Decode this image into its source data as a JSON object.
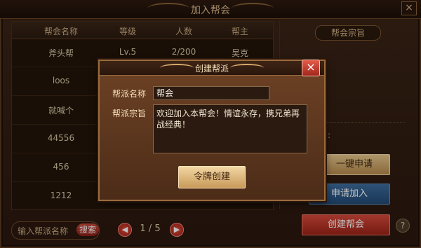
{
  "window": {
    "title": "加入帮会",
    "close_glyph": "×"
  },
  "guild_table": {
    "headers": [
      "帮会名称",
      "等级",
      "人数",
      "帮主"
    ],
    "rows": [
      [
        "斧头帮",
        "Lv.5",
        "2/200",
        "吴克"
      ],
      [
        "loos",
        "",
        "",
        ""
      ],
      [
        "就喊个",
        "",
        "",
        ""
      ],
      [
        "44556",
        "",
        "",
        ""
      ],
      [
        "456",
        "",
        "",
        ""
      ],
      [
        "1212",
        "",
        "",
        ""
      ]
    ]
  },
  "right_panel": {
    "tenet_tab": "帮会宗旨",
    "partial_label": "名:",
    "buttons": {
      "one_click_apply": "一键申请",
      "apply_join": "申请加入",
      "create_guild": "创建帮会"
    },
    "help_icon": "?"
  },
  "bottom": {
    "search_placeholder": "输入帮派名称",
    "search_button": "搜索",
    "pager": {
      "text": "1 / 5",
      "prev_glyph": "◀",
      "next_glyph": "▶"
    }
  },
  "modal": {
    "title": "创建帮派",
    "close_glyph": "×",
    "name_label": "帮派名称",
    "name_value": "帮会",
    "tenet_label": "帮派宗旨",
    "tenet_value": "欢迎加入本帮会！情谊永存，携兄弟再战经典！",
    "create_button": "令牌创建"
  },
  "colors": {
    "accent_gold": "#c89a5a",
    "accent_red": "#b83a2d",
    "accent_blue": "#2f5f8f"
  }
}
